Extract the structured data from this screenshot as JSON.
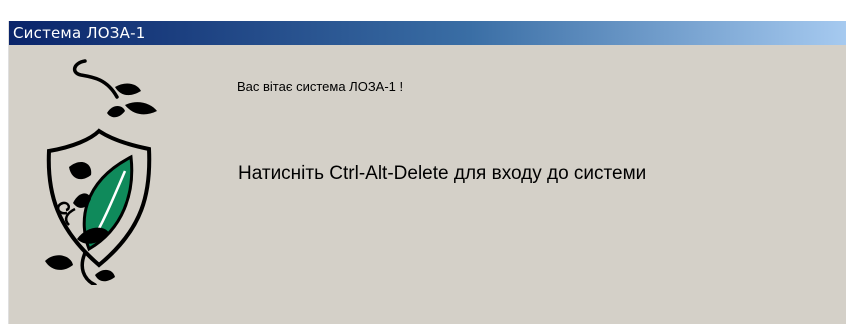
{
  "window": {
    "title": "Система ЛОЗА-1"
  },
  "content": {
    "welcome_text": "Вас вітає система ЛОЗА-1 !",
    "login_prompt": "Натисніть Ctrl-Alt-Delete для входу до системи"
  },
  "logo": {
    "icon": "vine-shield-logo-icon",
    "colors": {
      "leaf": "#0f8a5b",
      "outline": "#000000"
    }
  },
  "colors": {
    "title_start": "#0a246a",
    "title_end": "#a6caf0",
    "window_bg": "#d4d0c8"
  }
}
